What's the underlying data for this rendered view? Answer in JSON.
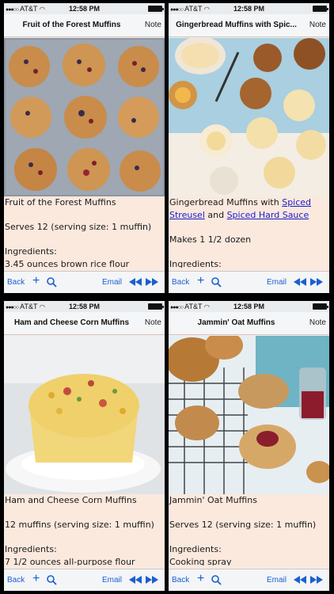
{
  "status_bar": {
    "carrier": "AT&T",
    "time": "12:58 PM"
  },
  "common": {
    "note": "Note",
    "back": "Back",
    "email": "Email"
  },
  "screens": [
    {
      "title": "Fruit of the Forest Muffins",
      "lines": [
        "Fruit of the Forest Muffins",
        "",
        "Serves 12 (serving size: 1 muffin)",
        "",
        "Ingredients:",
        "3.45 ounces brown rice flour"
      ]
    },
    {
      "title": "Gingerbread Muffins with Spic...",
      "line1": "Gingerbread Muffins with",
      "link1": "Spiced",
      "link2": "Streusel",
      "and": "and",
      "link3": "Spiced Hard Sauce",
      "lines": [
        "",
        "Makes 1 1/2 dozen",
        "",
        "Ingredients:"
      ]
    },
    {
      "title": "Ham and Cheese Corn Muffins",
      "lines": [
        "Ham and Cheese Corn Muffins",
        "",
        "12 muffins (serving size: 1 muffin)",
        "",
        "Ingredients:",
        "7 1/2 ounces all-purpose flour"
      ]
    },
    {
      "title": "Jammin' Oat Muffins",
      "lines": [
        "Jammin' Oat Muffins",
        "",
        "Serves 12 (serving size: 1 muffin)",
        "",
        "Ingredients:",
        "Cooking spray"
      ]
    }
  ],
  "icons": {
    "add": "plus-icon",
    "search": "magnifier-icon",
    "previous": "rewind-icon",
    "next": "fast-forward-icon",
    "battery": "battery-icon",
    "wifi": "wifi-icon"
  },
  "colors": {
    "page_bg": "#fbe9de",
    "link": "#1b1bcc",
    "toolbar_text": "#1a5fd0"
  }
}
